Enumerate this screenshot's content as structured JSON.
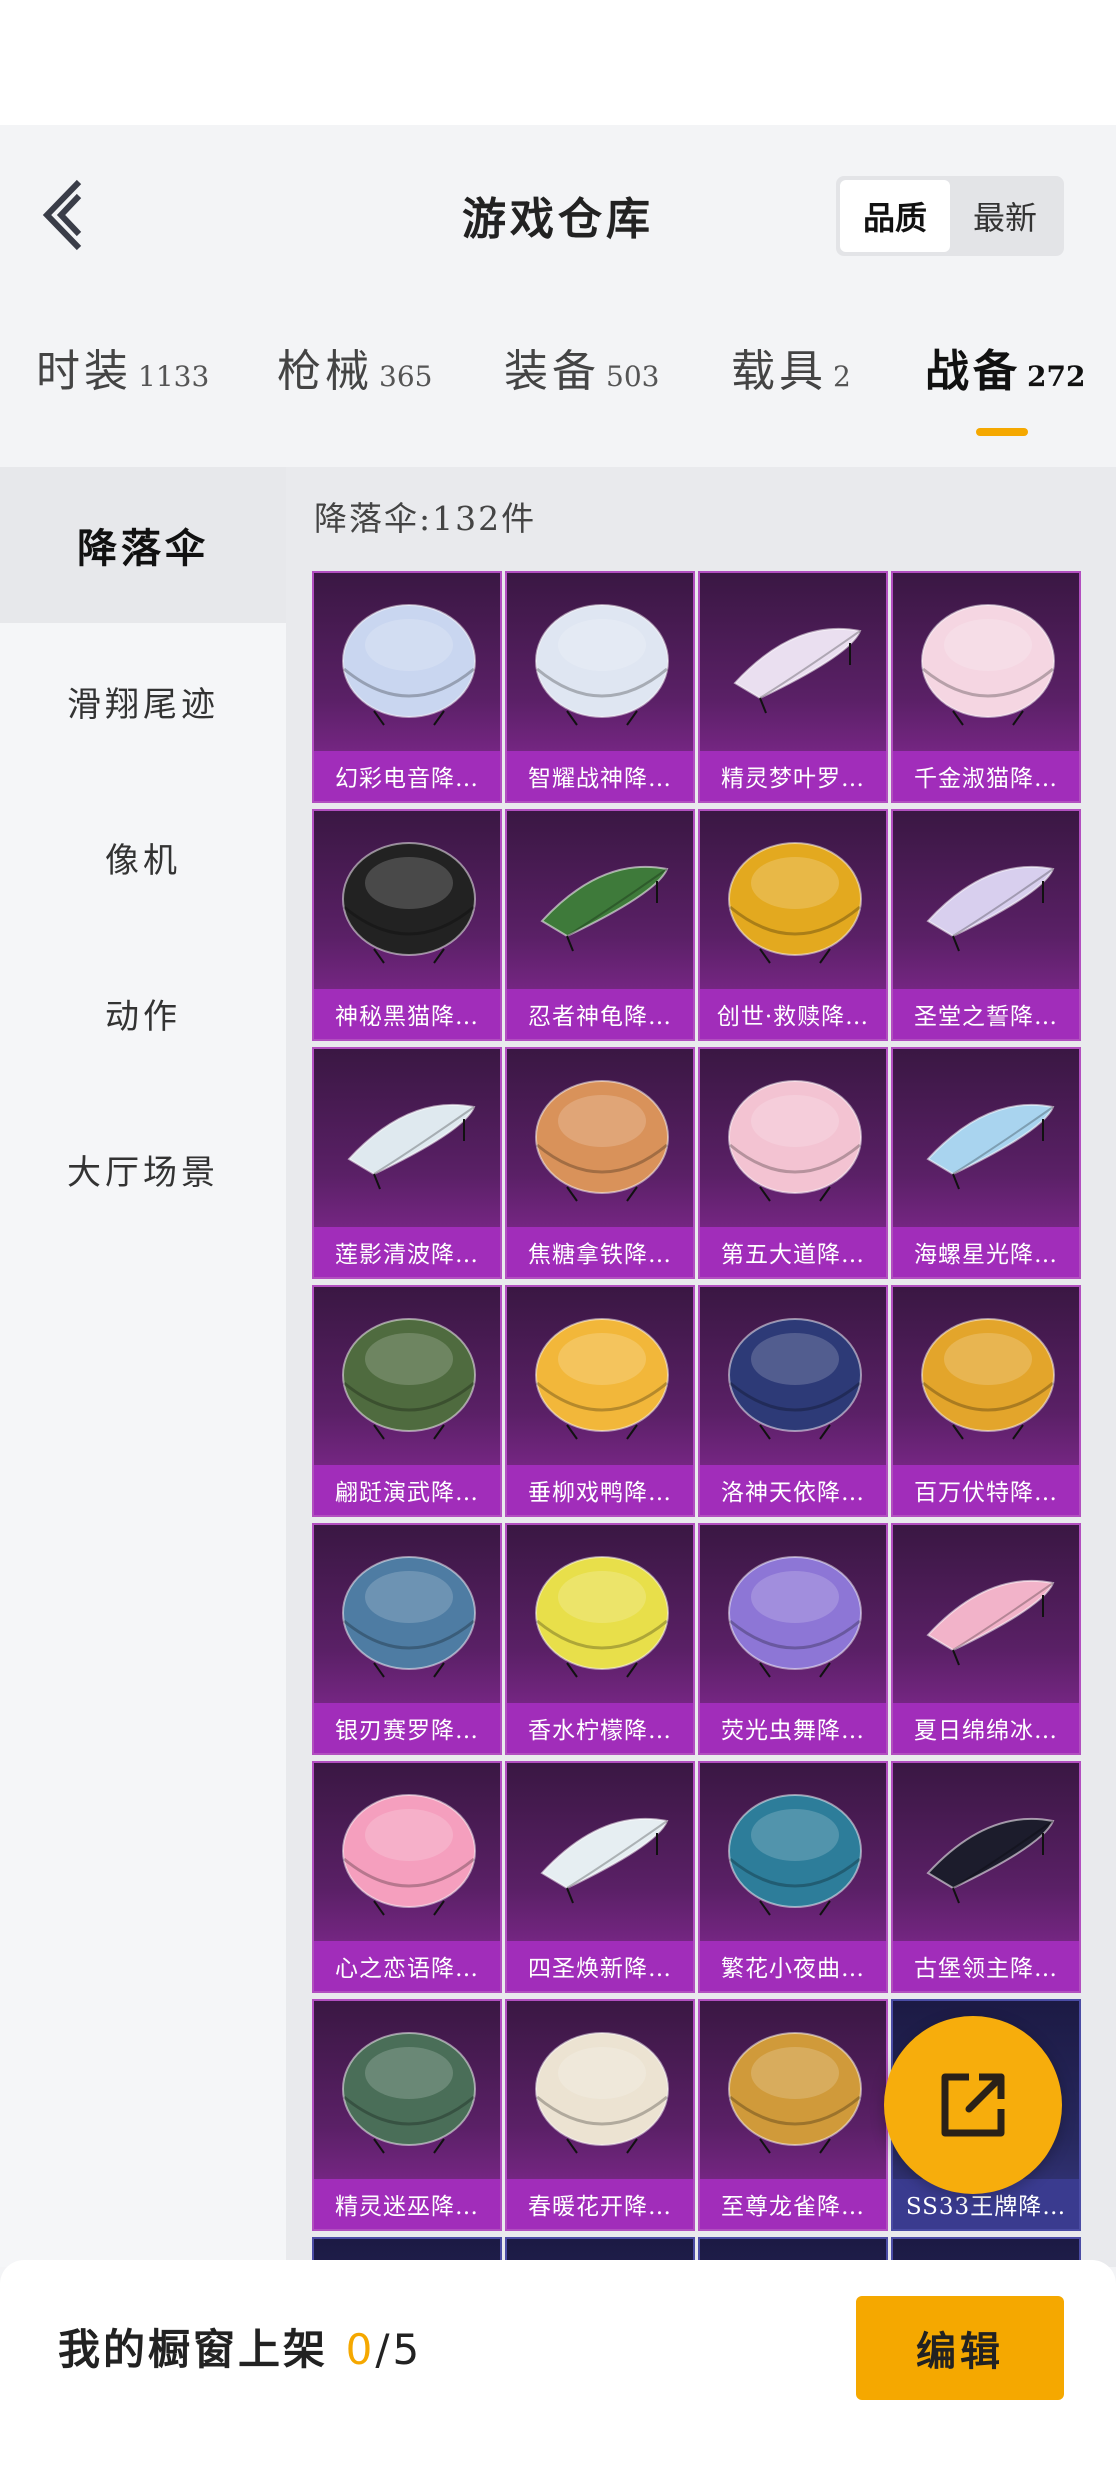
{
  "header": {
    "title": "游戏仓库",
    "sort_options": [
      "品质",
      "最新"
    ],
    "sort_active": "品质"
  },
  "category_tabs": [
    {
      "name": "时装",
      "count": "1133"
    },
    {
      "name": "枪械",
      "count": "365"
    },
    {
      "name": "装备",
      "count": "503"
    },
    {
      "name": "载具",
      "count": "2"
    },
    {
      "name": "战备",
      "count": "272",
      "active": true
    }
  ],
  "sidebar": {
    "items": [
      {
        "label": "降落伞",
        "active": true
      },
      {
        "label": "滑翔尾迹"
      },
      {
        "label": "像机"
      },
      {
        "label": "动作"
      },
      {
        "label": "大厅场景"
      }
    ]
  },
  "content": {
    "count_label": "降落伞:132件",
    "items": [
      {
        "name": "幻彩电音降…",
        "icon": "parachute-icon",
        "color": "#c9d6f0"
      },
      {
        "name": "智耀战神降…",
        "icon": "parachute-icon",
        "color": "#dfe6f2"
      },
      {
        "name": "精灵梦叶罗…",
        "icon": "glider-icon",
        "color": "#eadff0"
      },
      {
        "name": "千金淑猫降…",
        "icon": "parachute-icon",
        "color": "#f5d6e2"
      },
      {
        "name": "神秘黑猫降…",
        "icon": "parachute-icon",
        "color": "#222222"
      },
      {
        "name": "忍者神龟降…",
        "icon": "glider-icon",
        "color": "#3e7a3a"
      },
      {
        "name": "创世·救赎降…",
        "icon": "parachute-icon",
        "color": "#e3a91f"
      },
      {
        "name": "圣堂之誓降…",
        "icon": "glider-icon",
        "color": "#d8cfee"
      },
      {
        "name": "莲影清波降…",
        "icon": "glider-icon",
        "color": "#dfe9ef"
      },
      {
        "name": "焦糖拿铁降…",
        "icon": "parachute-icon",
        "color": "#d9925a"
      },
      {
        "name": "第五大道降…",
        "icon": "parachute-icon",
        "color": "#f3c3d2"
      },
      {
        "name": "海螺星光降…",
        "icon": "glider-icon",
        "color": "#a9d4ef"
      },
      {
        "name": "翩跹演武降…",
        "icon": "parachute-icon",
        "color": "#4f6b3f"
      },
      {
        "name": "垂柳戏鸭降…",
        "icon": "parachute-icon",
        "color": "#f2b73a"
      },
      {
        "name": "洛神天依降…",
        "icon": "parachute-icon",
        "color": "#2d3a77"
      },
      {
        "name": "百万伏特降…",
        "icon": "parachute-icon",
        "color": "#e3a52b"
      },
      {
        "name": "银刃赛罗降…",
        "icon": "parachute-icon",
        "color": "#4e7ca3"
      },
      {
        "name": "香水柠檬降…",
        "icon": "parachute-icon",
        "color": "#e8df4a"
      },
      {
        "name": "荧光虫舞降…",
        "icon": "parachute-icon",
        "color": "#8d76d6"
      },
      {
        "name": "夏日绵绵冰…",
        "icon": "glider-icon",
        "color": "#f2b3c9"
      },
      {
        "name": "心之恋语降…",
        "icon": "parachute-icon",
        "color": "#f59fbe"
      },
      {
        "name": "四圣焕新降…",
        "icon": "glider-icon",
        "color": "#e6eef2"
      },
      {
        "name": "繁花小夜曲…",
        "icon": "parachute-icon",
        "color": "#2d7d9a"
      },
      {
        "name": "古堡领主降…",
        "icon": "glider-icon",
        "color": "#1c1c2c"
      },
      {
        "name": "精灵迷巫降…",
        "icon": "parachute-icon",
        "color": "#4a6e58"
      },
      {
        "name": "春暖花开降…",
        "icon": "parachute-icon",
        "color": "#ece3d2"
      },
      {
        "name": "至尊龙雀降…",
        "icon": "parachute-icon",
        "color": "#d09a3a"
      },
      {
        "name": "SS33王牌降…",
        "icon": "parachute-icon",
        "color": "#3b5fa0",
        "tier": "blue"
      }
    ]
  },
  "bottom_bar": {
    "showcase_prefix": "我的橱窗上架 ",
    "showcase_current": "0",
    "showcase_total": "/5",
    "edit_label": "编辑"
  },
  "colors": {
    "accent": "#f5a800",
    "card_purple": "#a12dba",
    "card_blue": "#3a3b8f"
  },
  "icons": {
    "back": "chevron-left-icon",
    "share": "share-icon"
  }
}
